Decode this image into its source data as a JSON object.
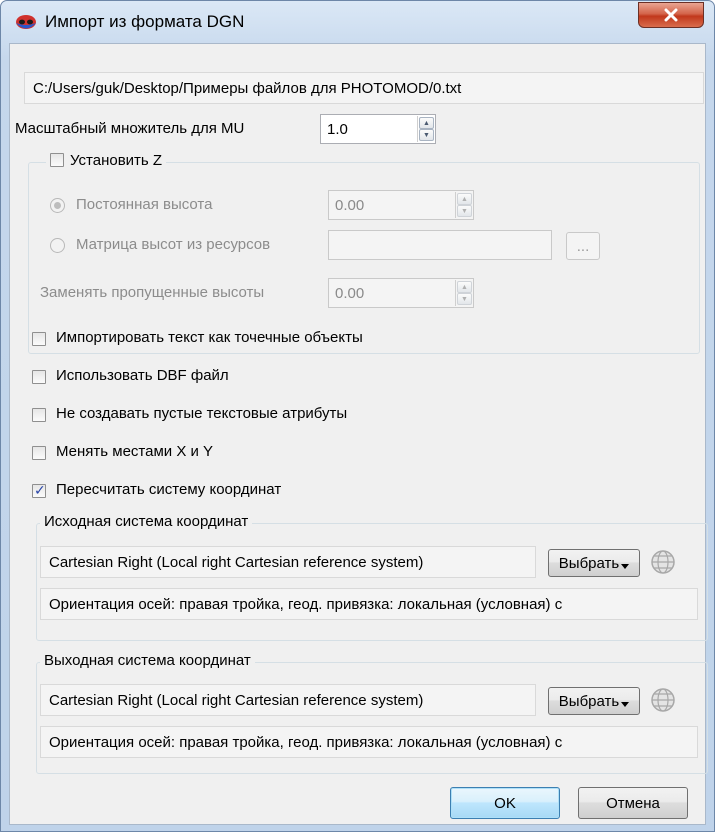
{
  "window": {
    "title": "Импорт из формата DGN"
  },
  "file_path": "C:/Users/guk/Desktop/Примеры файлов для PHOTOMOD/0.txt",
  "scale_factor": {
    "label": "Масштабный множитель для MU",
    "value": "1.0"
  },
  "set_z": {
    "label": "Установить Z",
    "checked": false,
    "constant_height": {
      "label": "Постоянная высота",
      "value": "0.00"
    },
    "height_matrix": {
      "label": "Матрица высот из ресурсов",
      "value": "",
      "browse_label": "..."
    },
    "replace_missing": {
      "label": "Заменять пропущенные высоты",
      "value": "0.00"
    }
  },
  "options": [
    {
      "label": "Импортировать текст как точечные объекты",
      "checked": false
    },
    {
      "label": "Использовать DBF файл",
      "checked": false
    },
    {
      "label": "Не создавать пустые текстовые атрибуты",
      "checked": false
    },
    {
      "label": "Менять местами X и Y",
      "checked": false
    },
    {
      "label": "Пересчитать систему координат",
      "checked": true
    }
  ],
  "source_cs": {
    "title": "Исходная система координат",
    "name": "Cartesian Right (Local right Cartesian reference system)",
    "select_label": "Выбрать",
    "description": "Ориентация осей: правая тройка, геод. привязка: локальная (условная) с"
  },
  "target_cs": {
    "title": "Выходная система координат",
    "name": "Cartesian Right (Local right Cartesian reference system)",
    "select_label": "Выбрать",
    "description": "Ориентация осей: правая тройка, геод. привязка: локальная (условная) с"
  },
  "buttons": {
    "ok": "OK",
    "cancel": "Отмена"
  },
  "colors": {
    "checkmark": "#2a46a8",
    "close_button": "#c1381c",
    "titlebar": "#c5d7ec"
  },
  "icons": {
    "app": "app-icon",
    "close": "close-icon",
    "globe": "globe-icon",
    "dropdown": "dropdown-arrow-icon"
  }
}
